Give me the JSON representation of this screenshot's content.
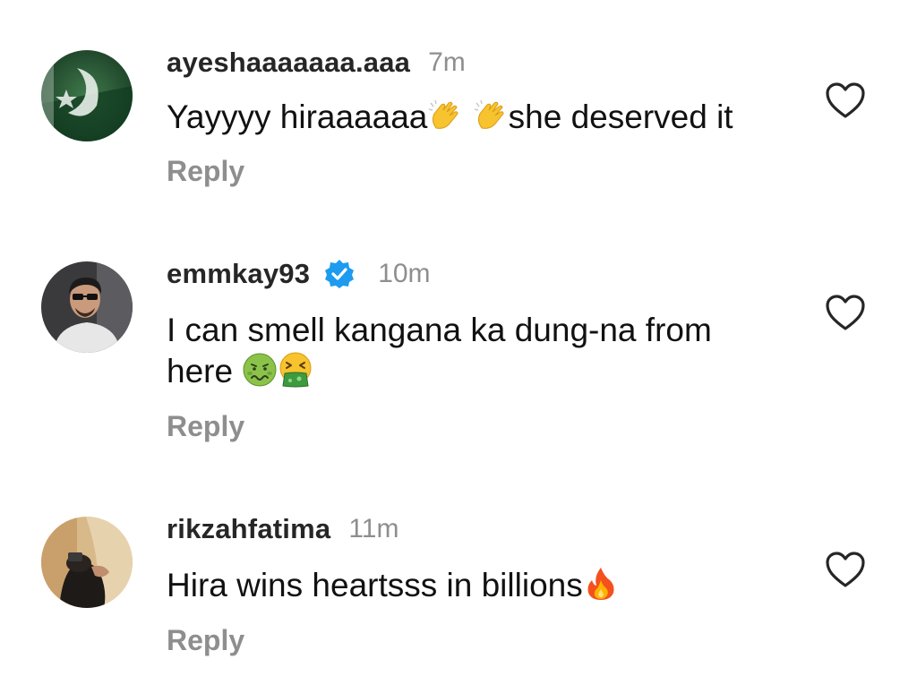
{
  "comments": [
    {
      "username": "ayeshaaaaaaa.aaa",
      "time": "7m",
      "verified": false,
      "text_parts": [
        "Yayyyy hiraaaaaa",
        " ",
        "she deserved it"
      ],
      "emojis": [
        "clapping-hands",
        "clapping-hands"
      ],
      "reply_label": "Reply"
    },
    {
      "username": "emmkay93",
      "time": "10m",
      "verified": true,
      "text_line1": "I can smell kangana ka dung-na from",
      "text_line2": "here ",
      "emojis": [
        "nauseated-face",
        "vomiting-face"
      ],
      "reply_label": "Reply"
    },
    {
      "username": "rikzahfatima",
      "time": "11m",
      "verified": false,
      "text": "Hira wins heartsss in billions",
      "emojis": [
        "fire"
      ],
      "reply_label": "Reply"
    }
  ],
  "colors": {
    "username": "#262626",
    "meta": "#8e8e8e",
    "verified": "#1d9bf0"
  },
  "icons": {
    "like": "heart-outline-icon",
    "verified": "verified-badge-icon"
  }
}
